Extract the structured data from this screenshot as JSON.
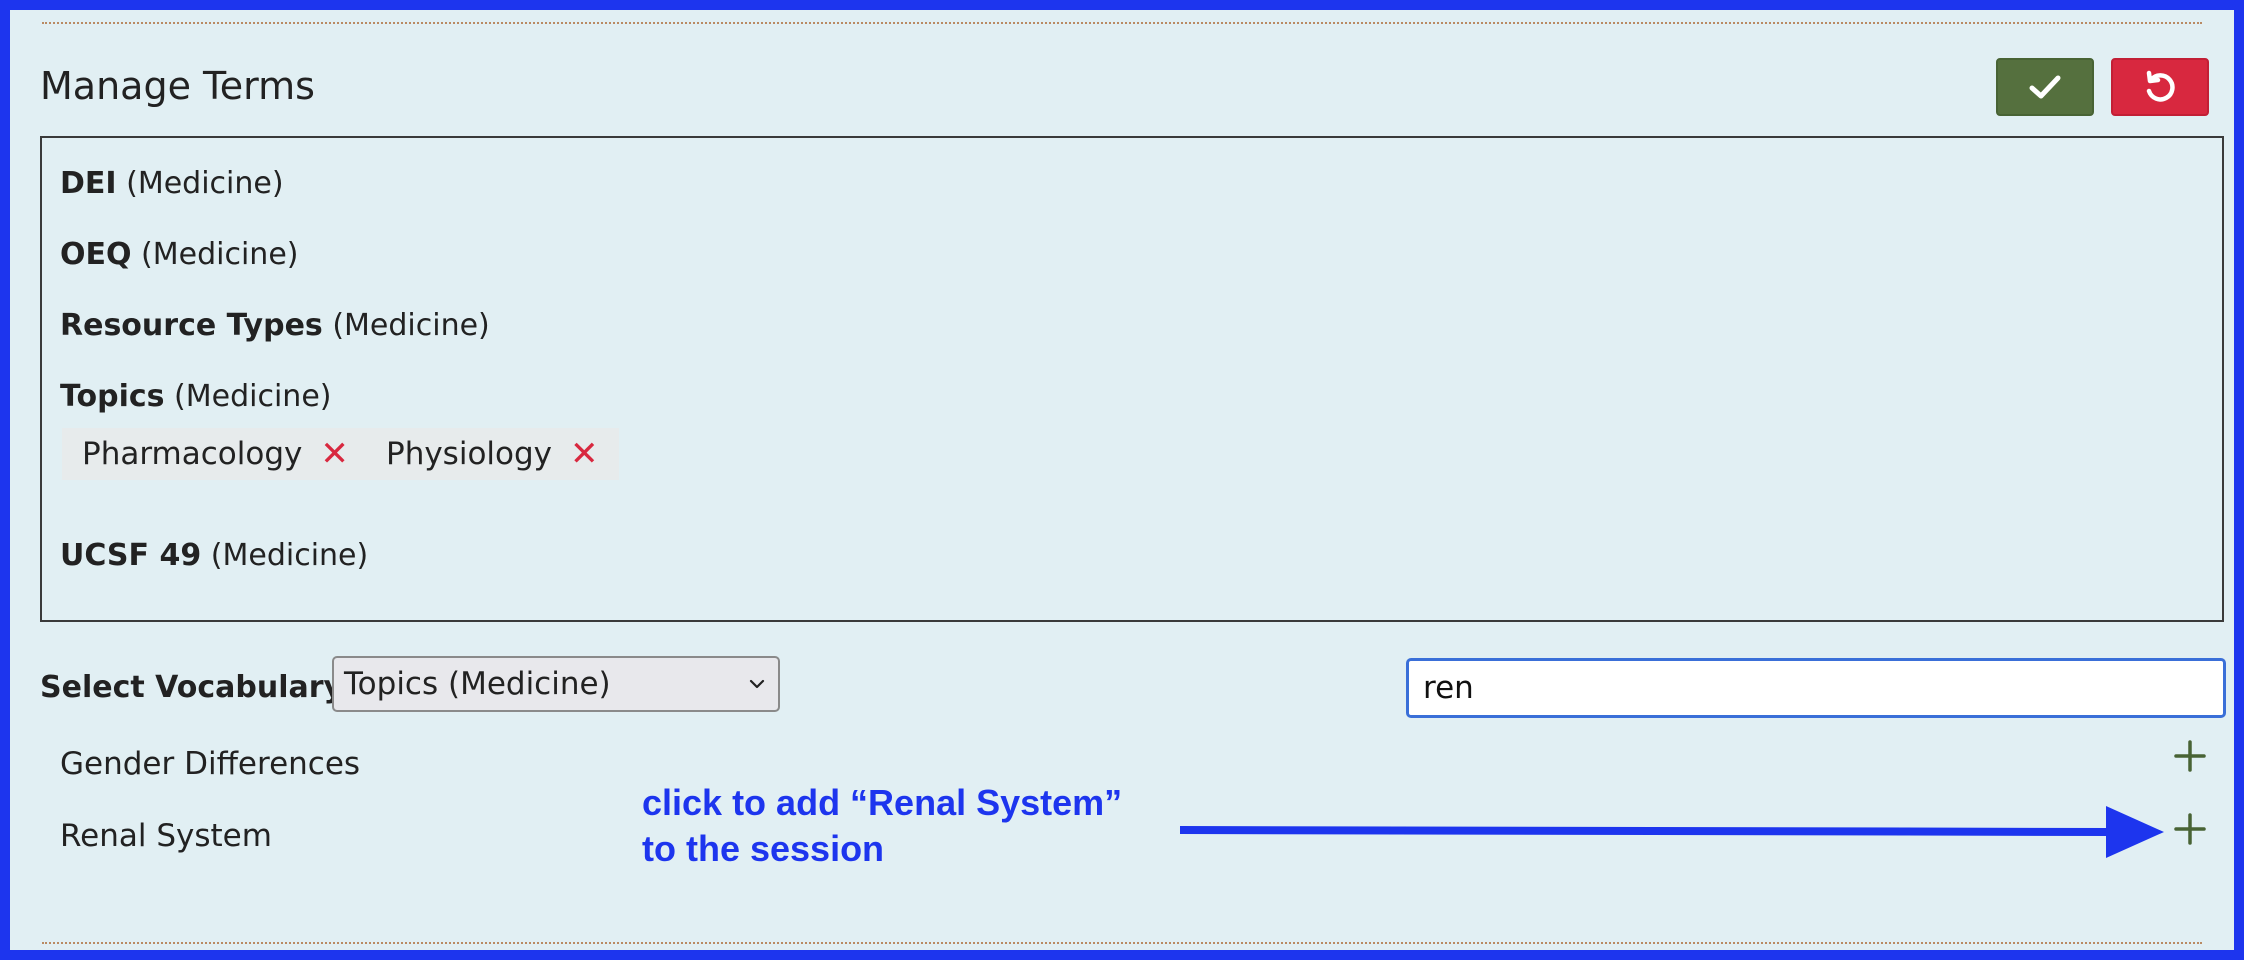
{
  "panel": {
    "title": "Manage Terms",
    "save_icon": "checkmark-icon",
    "cancel_icon": "undo-icon",
    "save_color": "#55703e",
    "cancel_color": "#d8283f"
  },
  "terms": [
    {
      "name": "DEI",
      "school": "(Medicine)"
    },
    {
      "name": "OEQ",
      "school": "(Medicine)"
    },
    {
      "name": "Resource Types",
      "school": "(Medicine)"
    },
    {
      "name": "Topics",
      "school": "(Medicine)"
    },
    {
      "name": "UCSF 49",
      "school": "(Medicine)"
    }
  ],
  "selected_topics": [
    {
      "label": "Pharmacology",
      "remove": "✕"
    },
    {
      "label": "Physiology",
      "remove": "✕"
    }
  ],
  "vocabulary": {
    "label": "Select Vocabulary:",
    "selected": "Topics (Medicine)"
  },
  "search": {
    "value": "ren"
  },
  "results": [
    {
      "label": "Gender Differences"
    },
    {
      "label": "Renal System"
    }
  ],
  "annotation": {
    "line1": "click to add “Renal System”",
    "line2": "to the session",
    "color": "#1d35ee"
  }
}
